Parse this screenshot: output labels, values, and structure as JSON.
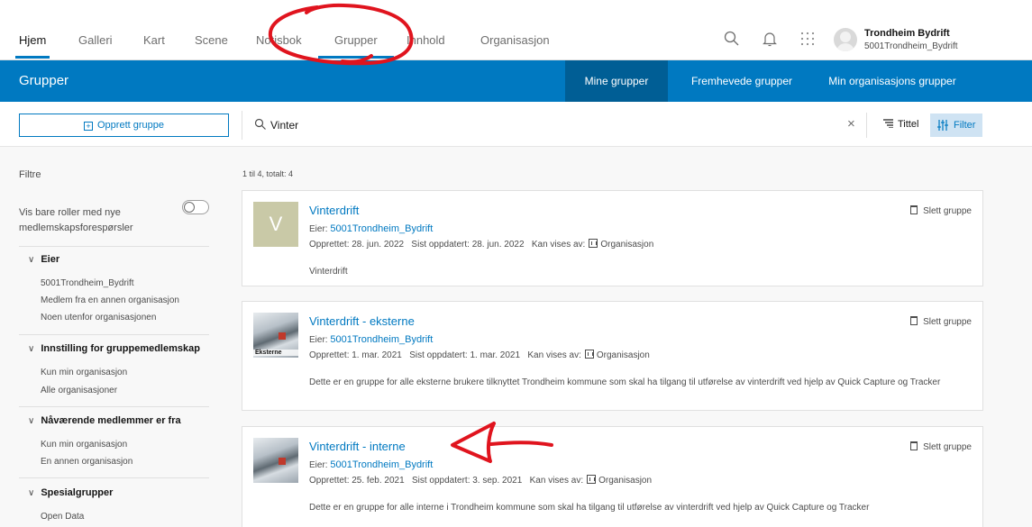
{
  "topnav": {
    "tabs": [
      {
        "label": "Hjem",
        "active": true
      },
      {
        "label": "Galleri"
      },
      {
        "label": "Kart"
      },
      {
        "label": "Scene"
      },
      {
        "label": "Notisbok"
      },
      {
        "label": "Grupper"
      },
      {
        "label": "Innhold"
      },
      {
        "label": "Organisasjon"
      }
    ],
    "icons": [
      "search-icon",
      "bell-icon",
      "apps-grid-icon"
    ],
    "user": {
      "name": "Trondheim Bydrift",
      "username": "5001Trondheim_Bydrift"
    }
  },
  "header": {
    "title": "Grupper",
    "tabs": [
      {
        "label": "Mine grupper",
        "active": true
      },
      {
        "label": "Fremhevede grupper"
      },
      {
        "label": "Min organisasjons grupper"
      }
    ]
  },
  "toolbar": {
    "create_label": "Opprett gruppe",
    "search_value": "Vinter",
    "sort_label": "Tittel",
    "filter_label": "Filter"
  },
  "sidebar": {
    "title": "Filtre",
    "toggle_label": "Vis bare roller med nye medlemskapsforespørsler",
    "sections": [
      {
        "title": "Eier",
        "items": [
          "5001Trondheim_Bydrift",
          "Medlem fra en annen organisasjon",
          "Noen utenfor organisasjonen"
        ]
      },
      {
        "title": "Innstilling for gruppemedlemskap",
        "items": [
          "Kun min organisasjon",
          "Alle organisasjoner"
        ]
      },
      {
        "title": "Nåværende medlemmer er fra",
        "items": [
          "Kun min organisasjon",
          "En annen organisasjon"
        ]
      },
      {
        "title": "Spesialgrupper",
        "items": [
          "Open Data"
        ]
      }
    ]
  },
  "results": {
    "count_text": "1 til 4, totalt: 4",
    "owner_prefix": "Eier:",
    "created_prefix": "Opprettet:",
    "updated_prefix": "Sist oppdatert:",
    "visible_prefix": "Kan vises av:",
    "delete_label": "Slett gruppe",
    "cards": [
      {
        "thumb_letter": "V",
        "title": "Vinterdrift",
        "owner": "5001Trondheim_Bydrift",
        "created": "28. jun. 2022",
        "updated": "28. jun. 2022",
        "visibility": "Organisasjon",
        "description": "Vinterdrift"
      },
      {
        "thumb_label": "Eksterne",
        "title": "Vinterdrift - eksterne",
        "owner": "5001Trondheim_Bydrift",
        "created": "1. mar. 2021",
        "updated": "1. mar. 2021",
        "visibility": "Organisasjon",
        "description": "Dette er en gruppe for alle eksterne brukere tilknyttet Trondheim kommune som skal ha tilgang til utførelse av vinterdrift ved hjelp av Quick Capture og Tracker"
      },
      {
        "title": "Vinterdrift - interne",
        "owner": "5001Trondheim_Bydrift",
        "created": "25. feb. 2021",
        "updated": "3. sep. 2021",
        "visibility": "Organisasjon",
        "description": "Dette er en gruppe for alle interne i Trondheim kommune som skal ha tilgang til utførelse av vinterdrift ved hjelp av Quick Capture og Tracker"
      }
    ]
  },
  "colors": {
    "accent": "#0079c1",
    "annotation": "#e0141e"
  }
}
